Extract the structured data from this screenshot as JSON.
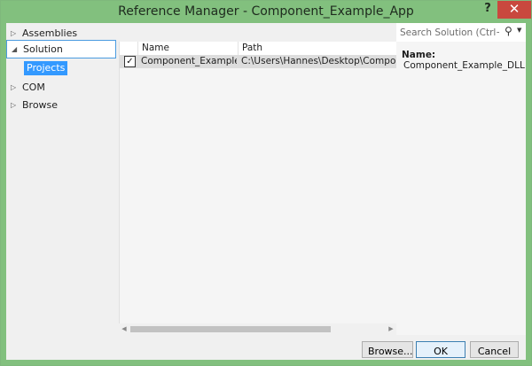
{
  "window": {
    "title": "Reference Manager - Component_Example_App",
    "help_label": "?",
    "close_label": "✕"
  },
  "nav": {
    "items": [
      {
        "label": "Assemblies",
        "expanded": false
      },
      {
        "label": "Solution",
        "expanded": true,
        "selected": true
      },
      {
        "label": "COM",
        "expanded": false
      },
      {
        "label": "Browse",
        "expanded": false
      }
    ],
    "sub_item": "Projects",
    "collapsed_glyph": "▷",
    "expanded_glyph": "◢"
  },
  "list": {
    "columns": [
      "Name",
      "Path"
    ],
    "rows": [
      {
        "checked": true,
        "name": "Component_Example_DLL",
        "path": "C:\\Users\\Hannes\\Desktop\\Component_Example"
      }
    ]
  },
  "search": {
    "placeholder": "Search Solution (Ctrl+E)",
    "icon": "search-icon"
  },
  "details": {
    "name_label": "Name:",
    "name_value": "Component_Example_DLL"
  },
  "footer": {
    "browse_label": "Browse...",
    "ok_label": "OK",
    "cancel_label": "Cancel"
  },
  "colors": {
    "title_bar": "#82c07e",
    "close_button": "#c9483e",
    "selection": "#3399ff"
  }
}
